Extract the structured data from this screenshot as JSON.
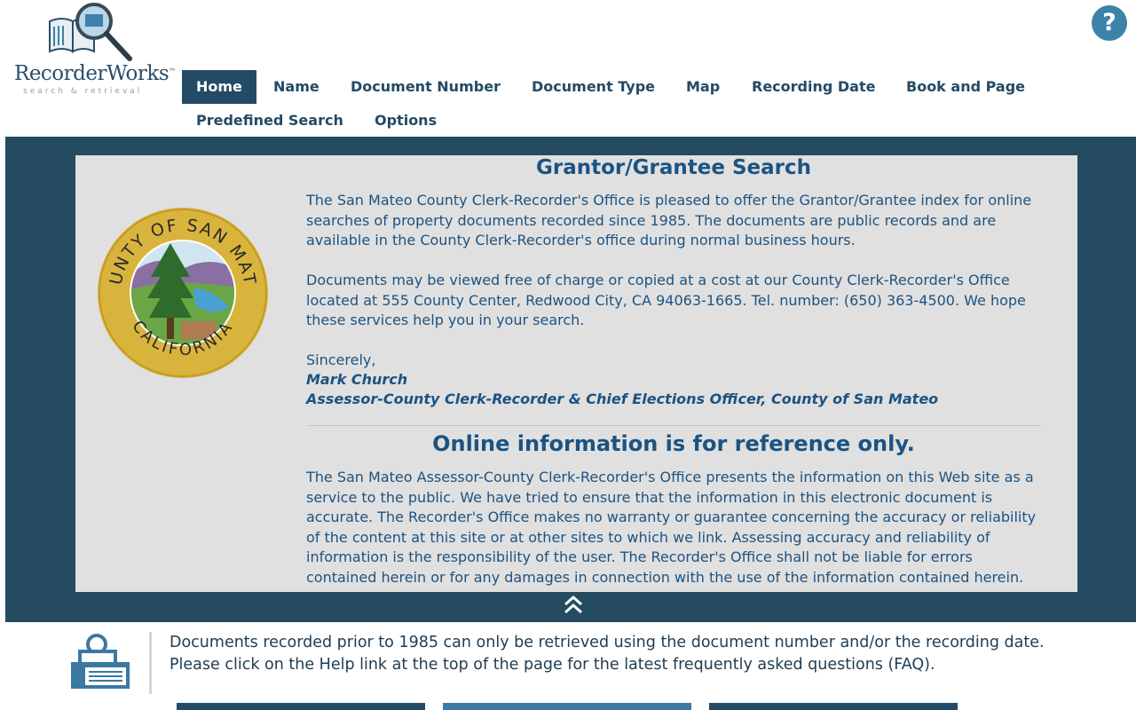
{
  "header": {
    "logo": {
      "name": "RecorderWorks",
      "trademark": "™",
      "tagline": "search & retrieval"
    },
    "help_label": "?"
  },
  "nav": {
    "items": [
      {
        "label": "Home",
        "active": true
      },
      {
        "label": "Name"
      },
      {
        "label": "Document Number"
      },
      {
        "label": "Document Type"
      },
      {
        "label": "Map"
      },
      {
        "label": "Recording Date"
      },
      {
        "label": "Book and Page"
      },
      {
        "label": "Predefined Search"
      },
      {
        "label": "Options"
      }
    ]
  },
  "main": {
    "seal": {
      "top_text": "COUNTY OF SAN MATEO",
      "bottom_text": "CALIFORNIA"
    },
    "title": "Grantor/Grantee Search",
    "paragraphs": [
      "The San Mateo County Clerk-Recorder's Office is pleased to offer the Grantor/Grantee index for online searches of property documents recorded since 1985. The documents are public records and are available in the County Clerk-Recorder's office during normal business hours.",
      "Documents may be viewed free of charge or copied at a cost at our County Clerk-Recorder's Office located at 555 County Center, Redwood City, CA 94063-1665. Tel. number: (650) 363-4500. We hope these services help you in your search.",
      "Sincerely,"
    ],
    "signature": {
      "name": "Mark Church",
      "title": "Assessor-County Clerk-Recorder & Chief Elections Officer, County of San Mateo"
    },
    "disclaimer_title": "Online information is for reference only.",
    "disclaimer_text": "The San Mateo Assessor-County Clerk-Recorder's Office presents the information on this Web site as a service to the public. We have tried to ensure that the information in this electronic document is accurate. The Recorder's Office makes no warranty or guarantee concerning the accuracy or reliability of the content at this site or at other sites to which we link. Assessing accuracy and reliability of information is the responsibility of the user. The Recorder's Office shall not be liable for errors contained herein or for any damages in connection with the use of the information contained herein."
  },
  "notice": {
    "line1": "Documents recorded prior to 1985 can only be retrieved using the document number and/or the recording date.",
    "line2": "Please click on the Help link at the top of the page for the latest frequently asked questions (FAQ)."
  },
  "colors": {
    "nav_active": "#234a66",
    "panel": "#244b60",
    "content_bg": "#e0e0e0",
    "text_blue": "#1c5382",
    "help_btn": "#3c82aa"
  }
}
